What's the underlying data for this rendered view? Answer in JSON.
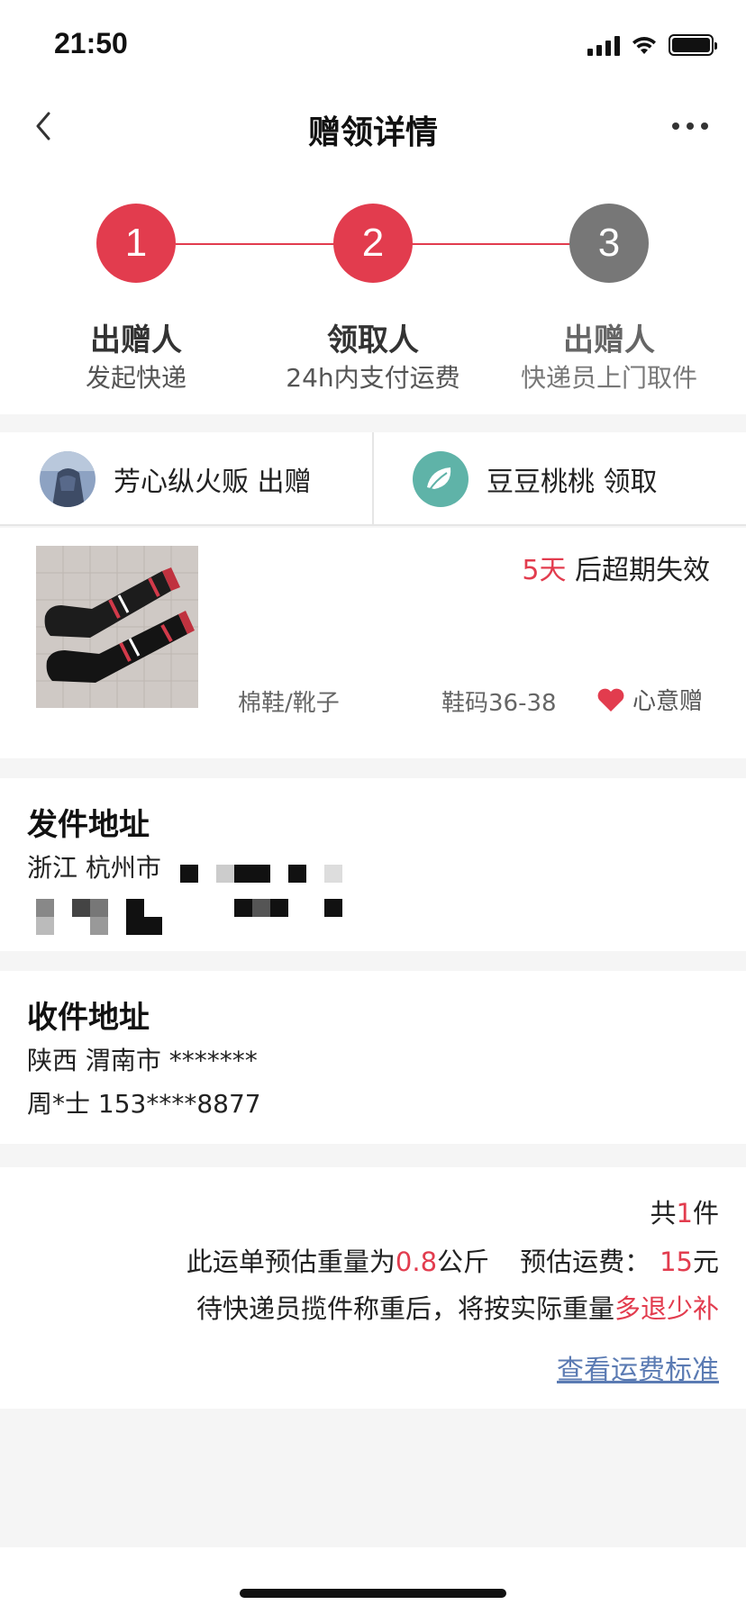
{
  "status_bar": {
    "time": "21:50",
    "battery_level": 1.0,
    "signal_bars": 4
  },
  "nav": {
    "title": "赠领详情",
    "back_icon": "chevron-left-icon",
    "more_icon": "more-dots-icon"
  },
  "steps": [
    {
      "number": "1",
      "title": "出赠人",
      "subtitle": "发起快递",
      "color": "#e23c4e"
    },
    {
      "number": "2",
      "title": "领取人",
      "subtitle": "24h内支付运费",
      "color": "#e23c4e"
    },
    {
      "number": "3",
      "title": "出赠人",
      "subtitle": "快递员上门取件",
      "color": "#777777"
    }
  ],
  "participants": {
    "giver": {
      "name_label": "芳心纵火贩 出赠"
    },
    "receiver": {
      "name_label": "豆豆桃桃 领取"
    }
  },
  "item": {
    "expire_days": "5天",
    "expire_text": " 后超期失效",
    "category": "棉鞋/靴子",
    "size": "鞋码36-38",
    "tag": "心意赠"
  },
  "sender_address": {
    "title": "发件地址",
    "line1": "浙江 杭州市"
  },
  "receiver_address": {
    "title": "收件地址",
    "line1": "陕西 渭南市 *******",
    "line2": "周*士 153****8877"
  },
  "shipping": {
    "count_prefix": "共",
    "count": "1",
    "count_suffix": "件",
    "weight_prefix": "此运单预估重量为",
    "weight": "0.8",
    "weight_unit": "公斤",
    "fee_label": "预估运费：",
    "fee": "15",
    "fee_unit": "元",
    "note_prefix": "待快递员揽件称重后，将按实际重量",
    "note_highlight": "多退少补",
    "link_text": "查看运费标准"
  },
  "colors": {
    "accent": "#e23c4e",
    "link": "#5b7bb3",
    "inactive_step": "#777777"
  }
}
